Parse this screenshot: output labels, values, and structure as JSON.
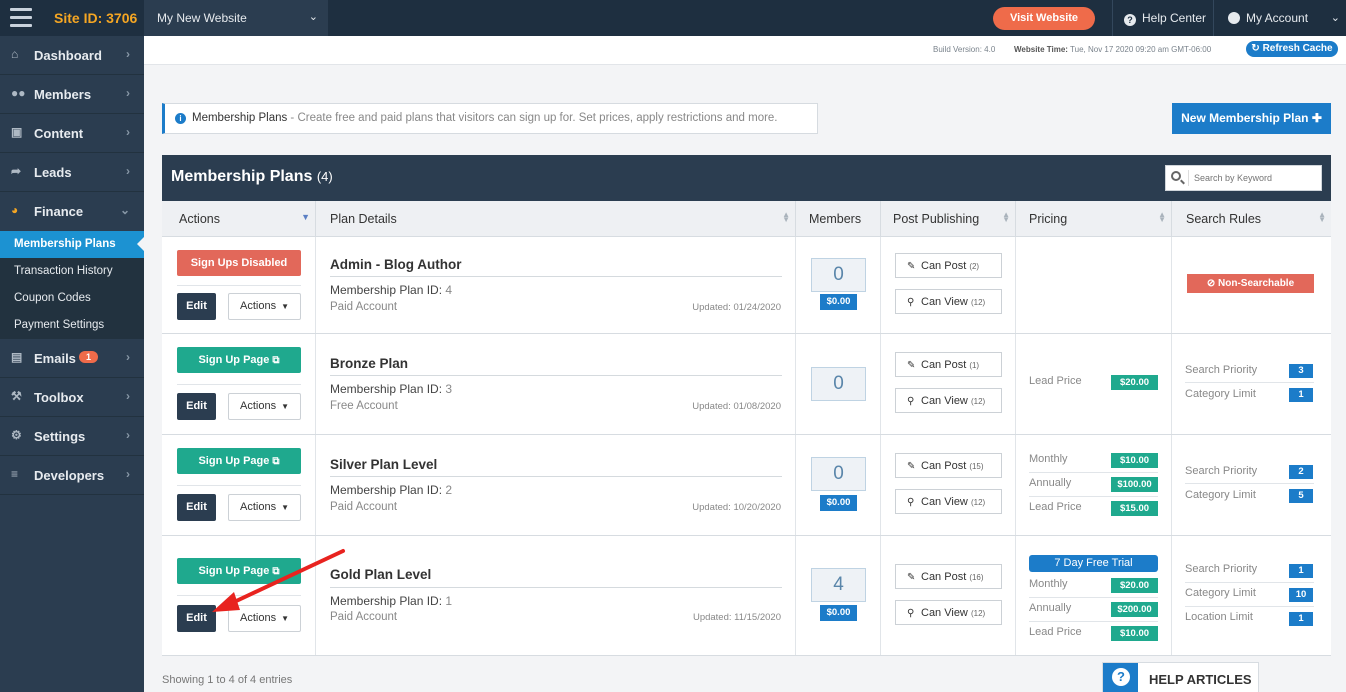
{
  "topbar": {
    "site_id": "Site ID: 3706",
    "site_name": "My New Website",
    "visit_website": "Visit Website",
    "help_center": "Help Center",
    "my_account": "My Account"
  },
  "sidebar": {
    "items": [
      {
        "label": "Dashboard",
        "icon": "home-icon"
      },
      {
        "label": "Members",
        "icon": "users-icon"
      },
      {
        "label": "Content",
        "icon": "folder-icon"
      },
      {
        "label": "Leads",
        "icon": "share-icon"
      },
      {
        "label": "Finance",
        "icon": "pie-chart-icon"
      },
      {
        "label": "Emails",
        "icon": "inbox-icon",
        "badge": "1"
      },
      {
        "label": "Toolbox",
        "icon": "wrench-icon"
      },
      {
        "label": "Settings",
        "icon": "gear-icon"
      },
      {
        "label": "Developers",
        "icon": "sliders-icon"
      }
    ],
    "finance_sub": [
      "Membership Plans",
      "Transaction History",
      "Coupon Codes",
      "Payment Settings"
    ]
  },
  "version_bar": {
    "build_version": "Build Version: 4.0",
    "website_time_label": "Website Time:",
    "website_time_value": "Tue, Nov 17 2020 09:20 am GMT-06:00",
    "refresh_cache": "Refresh Cache"
  },
  "info": {
    "title": "Membership Plans",
    "text": " - Create free and paid plans that visitors can sign up for. Set prices, apply restrictions and more."
  },
  "new_plan_button": "New Membership Plan",
  "panel": {
    "title": "Membership Plans",
    "count": "(4)",
    "search_placeholder": "Search by Keyword"
  },
  "columns": [
    "Actions",
    "Plan Details",
    "Members",
    "Post Publishing",
    "Pricing",
    "Search Rules"
  ],
  "labels": {
    "edit": "Edit",
    "actions": "Actions",
    "plan_id": "Membership Plan ID:",
    "can_post": "Can Post",
    "can_view": "Can View"
  },
  "rows": [
    {
      "primary_button": "Sign Ups Disabled",
      "name": "Admin - Blog Author",
      "id": "4",
      "type": "Paid Account",
      "updated": "Updated: 01/24/2020",
      "members": "0",
      "member_price": "$0.00",
      "can_post_count": "(2)",
      "can_view_count": "(12)",
      "search": {
        "non_searchable": "Non-Searchable"
      }
    },
    {
      "primary_button": "Sign Up Page",
      "name": "Bronze Plan",
      "id": "3",
      "type": "Free Account",
      "updated": "Updated: 01/08/2020",
      "members": "0",
      "can_post_count": "(1)",
      "can_view_count": "(12)",
      "pricing": [
        {
          "label": "Lead Price",
          "value": "$20.00"
        }
      ],
      "search": [
        {
          "label": "Search Priority",
          "value": "3"
        },
        {
          "label": "Category Limit",
          "value": "1"
        }
      ]
    },
    {
      "primary_button": "Sign Up Page",
      "name": "Silver Plan Level",
      "id": "2",
      "type": "Paid Account",
      "updated": "Updated: 10/20/2020",
      "members": "0",
      "member_price": "$0.00",
      "can_post_count": "(15)",
      "can_view_count": "(12)",
      "pricing": [
        {
          "label": "Monthly",
          "value": "$10.00"
        },
        {
          "label": "Annually",
          "value": "$100.00"
        },
        {
          "label": "Lead Price",
          "value": "$15.00"
        }
      ],
      "search": [
        {
          "label": "Search Priority",
          "value": "2"
        },
        {
          "label": "Category Limit",
          "value": "5"
        }
      ]
    },
    {
      "primary_button": "Sign Up Page",
      "name": "Gold Plan Level",
      "id": "1",
      "type": "Paid Account",
      "updated": "Updated: 11/15/2020",
      "members": "4",
      "member_price": "$0.00",
      "can_post_count": "(16)",
      "can_view_count": "(12)",
      "trial": "7 Day Free Trial",
      "pricing": [
        {
          "label": "Monthly",
          "value": "$20.00"
        },
        {
          "label": "Annually",
          "value": "$200.00"
        },
        {
          "label": "Lead Price",
          "value": "$10.00"
        }
      ],
      "search": [
        {
          "label": "Search Priority",
          "value": "1"
        },
        {
          "label": "Category Limit",
          "value": "10"
        },
        {
          "label": "Location Limit",
          "value": "1"
        }
      ]
    }
  ],
  "footer": {
    "entries": "Showing 1 to 4 of 4 entries",
    "help_articles": "HELP ARTICLES"
  },
  "colors": {
    "sidebar": "#2b3d50",
    "accent_blue": "#1c7cc9",
    "teal": "#1fa98e",
    "red": "#e2685a",
    "orange": "#ef6b4a",
    "arrow": "#e8231f"
  }
}
